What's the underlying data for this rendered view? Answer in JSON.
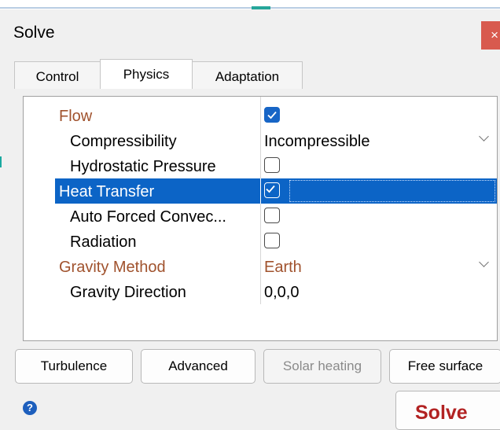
{
  "window": {
    "title": "Solve",
    "close_label": "×"
  },
  "tabs": [
    {
      "label": "Control",
      "active": false
    },
    {
      "label": "Physics",
      "active": true
    },
    {
      "label": "Adaptation",
      "active": false
    }
  ],
  "properties": [
    {
      "name": "Flow",
      "kind": "group",
      "type": "checkbox",
      "checked": true
    },
    {
      "name": "Compressibility",
      "kind": "item",
      "type": "dropdown",
      "value": "Incompressible"
    },
    {
      "name": "Hydrostatic Pressure",
      "kind": "item",
      "type": "checkbox",
      "checked": false
    },
    {
      "name": "Heat Transfer",
      "kind": "group",
      "type": "checkbox",
      "checked": true,
      "selected": true
    },
    {
      "name": "Auto Forced Convec...",
      "kind": "item",
      "type": "checkbox",
      "checked": false
    },
    {
      "name": "Radiation",
      "kind": "item",
      "type": "checkbox",
      "checked": false
    },
    {
      "name": "Gravity Method",
      "kind": "group",
      "type": "dropdown",
      "value": "Earth"
    },
    {
      "name": "Gravity Direction",
      "kind": "item",
      "type": "text",
      "value": "0,0,0"
    }
  ],
  "buttons": {
    "turbulence": "Turbulence",
    "advanced": "Advanced",
    "solar_heating": "Solar heating",
    "free_surface": "Free surface",
    "solve": "Solve",
    "help": "?"
  },
  "colors": {
    "group_text": "#a0522d",
    "selection": "#0c64c6",
    "checkbox_checked": "#1765c6",
    "solve_text": "#b22222",
    "close_button": "#d85a4e"
  }
}
